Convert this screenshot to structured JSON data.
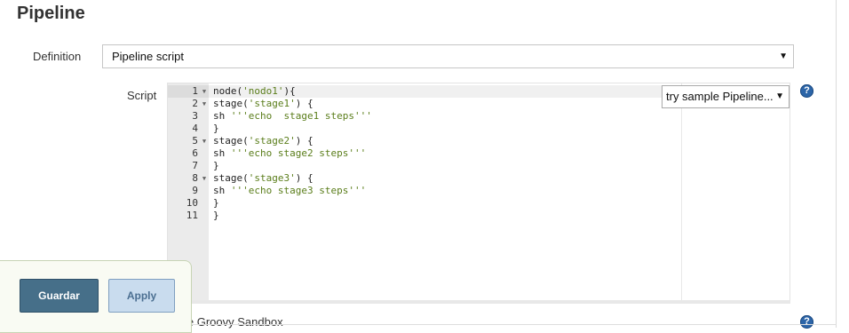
{
  "section": {
    "title": "Pipeline"
  },
  "definition": {
    "label": "Definition",
    "value": "Pipeline script"
  },
  "script": {
    "label": "Script",
    "sample_select": "try sample Pipeline...",
    "lines": [
      {
        "num": "1",
        "fold": true,
        "code": "node(",
        "str": "'nodo1'",
        "tail": "){"
      },
      {
        "num": "2",
        "fold": true,
        "code": "stage(",
        "str": "'stage1'",
        "tail": ") {"
      },
      {
        "num": "3",
        "fold": false,
        "code": "sh ",
        "str": "'''echo  stage1 steps'''",
        "tail": ""
      },
      {
        "num": "4",
        "fold": false,
        "code": "}",
        "str": "",
        "tail": ""
      },
      {
        "num": "5",
        "fold": true,
        "code": "stage(",
        "str": "'stage2'",
        "tail": ") {"
      },
      {
        "num": "6",
        "fold": false,
        "code": "sh ",
        "str": "'''echo stage2 steps'''",
        "tail": ""
      },
      {
        "num": "7",
        "fold": false,
        "code": "}",
        "str": "",
        "tail": ""
      },
      {
        "num": "8",
        "fold": true,
        "code": "stage(",
        "str": "'stage3'",
        "tail": ") {"
      },
      {
        "num": "9",
        "fold": false,
        "code": "sh ",
        "str": "'''echo stage3 steps'''",
        "tail": ""
      },
      {
        "num": "10",
        "fold": false,
        "code": "}",
        "str": "",
        "tail": ""
      },
      {
        "num": "11",
        "fold": false,
        "code": "}",
        "str": "",
        "tail": ""
      }
    ]
  },
  "sandbox": {
    "label": "Use Groovy Sandbox"
  },
  "buttons": {
    "save": "Guardar",
    "apply": "Apply"
  },
  "icons": {
    "help": "help-icon",
    "fold": "fold-arrow-icon",
    "caret": "chevron-down-icon"
  },
  "colors": {
    "save_button": "#466f89",
    "apply_button": "#c9dcee",
    "help_icon": "#2c65a8",
    "string": "#5a7d1a"
  }
}
